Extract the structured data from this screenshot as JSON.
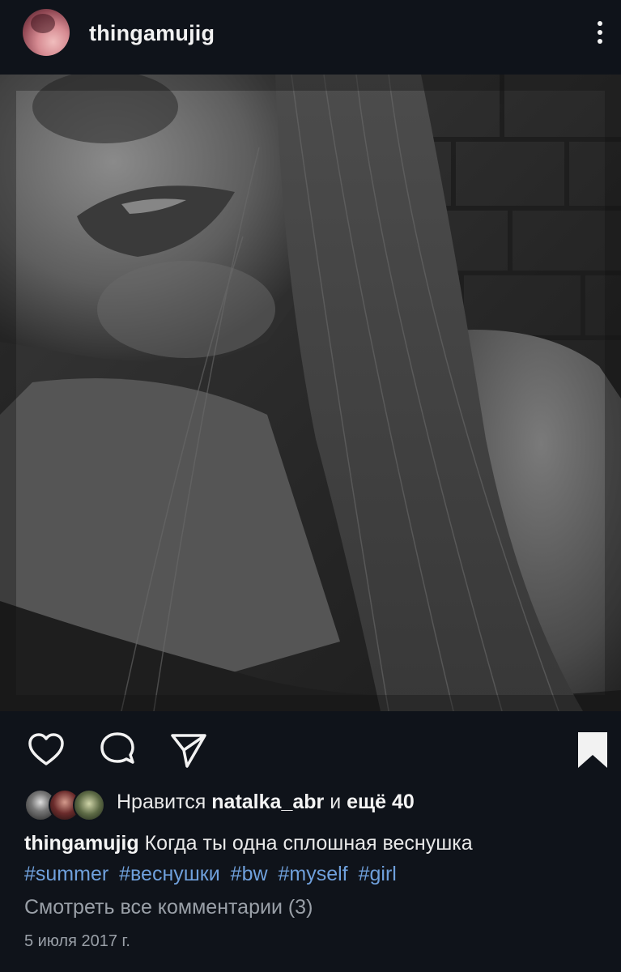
{
  "header": {
    "username": "thingamujig",
    "avatar_icon": "profile-avatar",
    "menu_icon": "more-vertical-icon"
  },
  "post": {
    "photo_description_icon": "photo",
    "actions": {
      "like_icon": "heart-icon",
      "comment_icon": "comment-bubble-icon",
      "share_icon": "paper-plane-icon",
      "save_icon": "bookmark-icon"
    },
    "likes": {
      "prefix": "Нравится",
      "liker": "natalka_abr",
      "connector": "и",
      "others": "ещё 40"
    },
    "caption": {
      "username": "thingamujig",
      "text": "Когда ты одна сплошная веснушка",
      "hashtags": [
        "#summer",
        "#веснушки",
        "#bw",
        "#myself",
        "#girl"
      ]
    },
    "view_comments": "Смотреть все комментарии (3)",
    "date": "5 июля 2017 г."
  },
  "colors": {
    "background": "#0f131a",
    "text": "#e8e8e8",
    "muted": "#9aa0a8",
    "hashtag": "#6fa0dc"
  }
}
